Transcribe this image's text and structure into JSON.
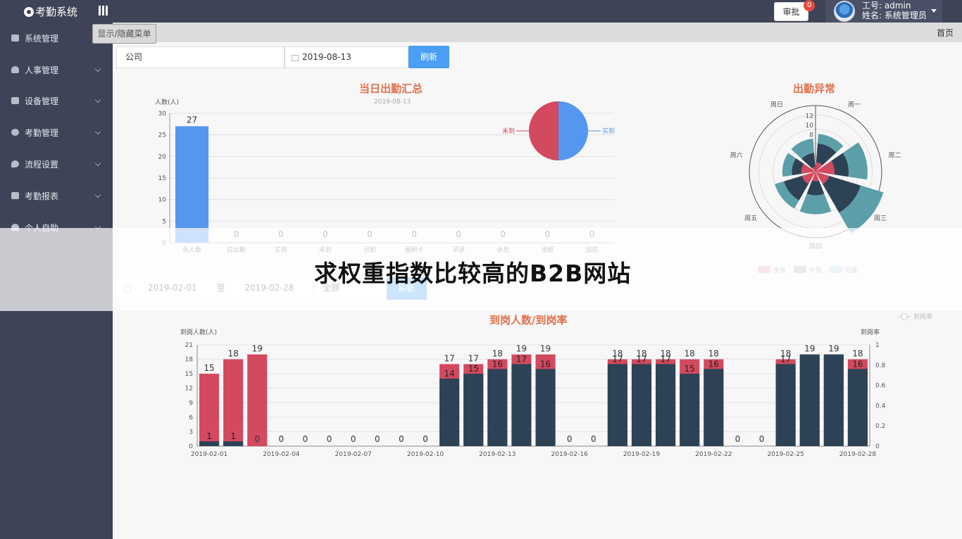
{
  "header": {
    "brand": "考勤系统",
    "approve_label": "审批",
    "approve_count": "0",
    "user_line1": "工号:  admin",
    "user_line2": "姓名:  系统管理员"
  },
  "tooltip": "显示/隐藏菜单",
  "tabs": {
    "home": "首页"
  },
  "sidebar": {
    "items": [
      {
        "label": "系统管理",
        "icon": "system-icon"
      },
      {
        "label": "人事管理",
        "icon": "user-icon"
      },
      {
        "label": "设备管理",
        "icon": "device-icon"
      },
      {
        "label": "考勤管理",
        "icon": "hand-icon"
      },
      {
        "label": "流程设置",
        "icon": "flow-icon"
      },
      {
        "label": "考勤报表",
        "icon": "table-icon"
      },
      {
        "label": "个人自助",
        "icon": "person-icon"
      }
    ]
  },
  "filter1": {
    "company": "公司",
    "date": "2019-08-13",
    "refresh": "刷新"
  },
  "filter2": {
    "start": "2019-02-01",
    "to": "至",
    "end": "2019-02-28",
    "scope": "全部",
    "refresh": "刷新"
  },
  "overlay_text": "求权重指数比较高的B2B网站",
  "colors": {
    "blue": "#5596f0",
    "red": "#d3495f",
    "dark": "#2e4255",
    "teal": "#5c9fa8",
    "title": "#e0714e"
  },
  "chart_data": [
    {
      "type": "bar",
      "title": "当日出勤汇总",
      "subtitle": "2019-08-13",
      "ylabel": "人数(人)",
      "ylim": [
        0,
        30
      ],
      "yticks": [
        0,
        5,
        10,
        15,
        20,
        25,
        30
      ],
      "categories": [
        "总人数",
        "应出勤",
        "实到",
        "未到",
        "迟到",
        "漏刷卡",
        "早退",
        "休息",
        "请假",
        "加班"
      ],
      "values": [
        27,
        0,
        0,
        0,
        0,
        0,
        0,
        0,
        0,
        0
      ]
    },
    {
      "type": "pie",
      "labels": [
        "实到",
        "未到"
      ],
      "values": [
        50,
        50
      ]
    },
    {
      "type": "polar-bar",
      "title": "出勤异常",
      "categories": [
        "周一",
        "周二",
        "周三",
        "周四",
        "周五",
        "周六",
        "周日"
      ],
      "rticks": [
        8,
        10,
        12
      ],
      "series": [
        {
          "name": "重度",
          "values": [
            2,
            4,
            3,
            2,
            3,
            3,
            1
          ]
        },
        {
          "name": "中度",
          "values": [
            4,
            3,
            7,
            3,
            4,
            2,
            3
          ]
        },
        {
          "name": "轻度",
          "values": [
            2,
            4,
            5,
            4,
            2,
            2,
            3
          ]
        }
      ]
    },
    {
      "type": "bar",
      "title": "到岗人数/到岗率",
      "ylabel": "到岗人数(人)",
      "y2label": "到岗率",
      "legend": "到岗率",
      "ylim": [
        0,
        21
      ],
      "yticks": [
        0,
        3,
        6,
        9,
        12,
        15,
        18,
        21
      ],
      "y2ticks": [
        "0",
        "0.2",
        "0.4",
        "0.6",
        "0.8",
        "1"
      ],
      "x_labels": [
        "2019-02-01",
        "2019-02-04",
        "2019-02-07",
        "2019-02-10",
        "2019-02-13",
        "2019-02-16",
        "2019-02-19",
        "2019-02-22",
        "2019-02-25",
        "2019-02-28"
      ],
      "days": [
        "2019-02-01",
        "2019-02-02",
        "2019-02-03",
        "2019-02-04",
        "2019-02-05",
        "2019-02-06",
        "2019-02-07",
        "2019-02-08",
        "2019-02-09",
        "2019-02-10",
        "2019-02-11",
        "2019-02-12",
        "2019-02-13",
        "2019-02-14",
        "2019-02-15",
        "2019-02-16",
        "2019-02-17",
        "2019-02-18",
        "2019-02-19",
        "2019-02-20",
        "2019-02-21",
        "2019-02-22",
        "2019-02-23",
        "2019-02-24",
        "2019-02-25",
        "2019-02-26",
        "2019-02-27",
        "2019-02-28"
      ],
      "totals": [
        15,
        18,
        19,
        0,
        0,
        0,
        0,
        0,
        0,
        0,
        17,
        17,
        18,
        19,
        19,
        0,
        0,
        18,
        18,
        18,
        18,
        18,
        0,
        0,
        18,
        19,
        19,
        18
      ],
      "present": [
        1,
        1,
        0,
        0,
        0,
        0,
        0,
        0,
        0,
        0,
        14,
        15,
        16,
        17,
        16,
        0,
        0,
        17,
        17,
        17,
        15,
        16,
        0,
        0,
        17,
        19,
        19,
        16
      ]
    }
  ]
}
